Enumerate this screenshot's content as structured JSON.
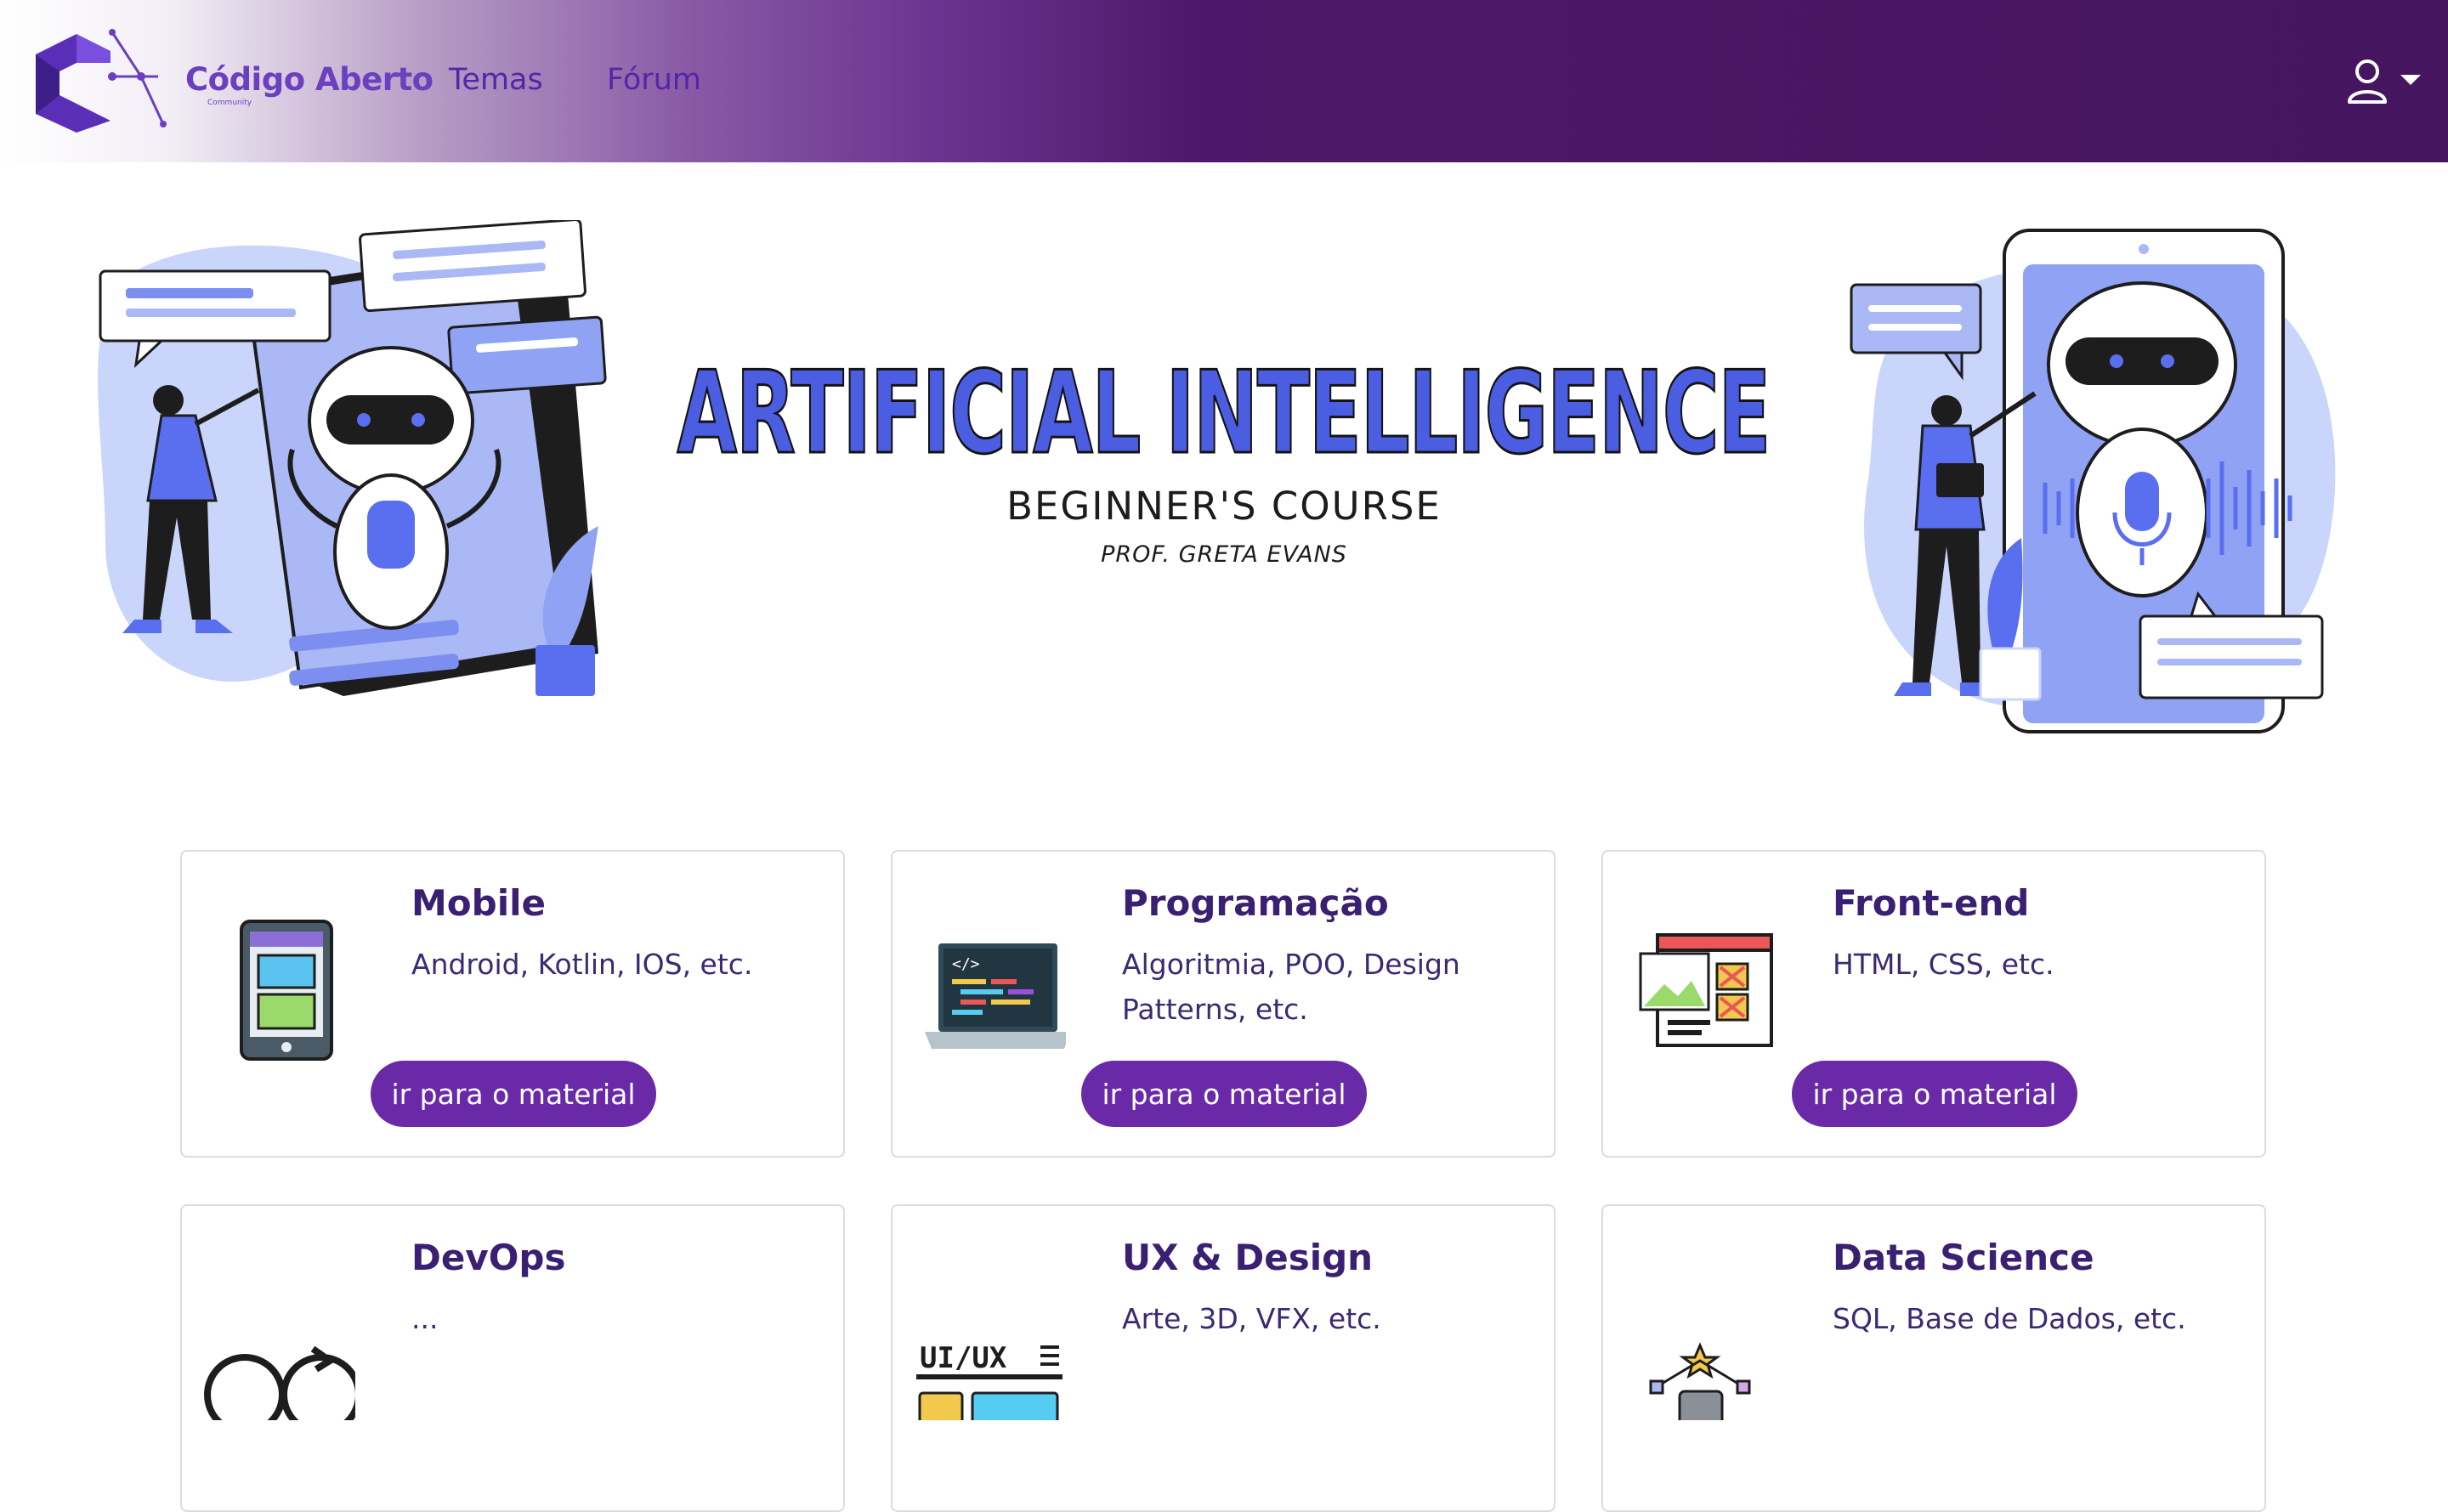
{
  "brand": {
    "name": "Código Aberto",
    "tagline": "Community"
  },
  "nav": {
    "temas": "Temas",
    "forum": "Fórum"
  },
  "hero": {
    "title": "ARTIFICIAL INTELLIGENCE",
    "subtitle": "BEGINNER'S COURSE",
    "author": "PROF. GRETA EVANS"
  },
  "cards": [
    {
      "title": "Mobile",
      "desc": "Android, Kotlin, IOS, etc.",
      "button": "ir para o material",
      "icon": "phone-icon"
    },
    {
      "title": "Programação",
      "desc": "Algoritmia, POO, Design Patterns, etc.",
      "button": "ir para o material",
      "icon": "laptop-code-icon"
    },
    {
      "title": "Front-end",
      "desc": "HTML, CSS, etc.",
      "button": "ir para o material",
      "icon": "web-design-icon"
    },
    {
      "title": "DevOps",
      "desc": "...",
      "icon": "devops-icon"
    },
    {
      "title": "UX & Design",
      "desc": "Arte, 3D, VFX, etc.",
      "icon": "ui-ux-icon"
    },
    {
      "title": "Data Science",
      "desc": "SQL, Base de Dados, etc.",
      "icon": "data-science-icon"
    }
  ],
  "colors": {
    "brand": "#6a3fc0",
    "button": "#6a2aa8",
    "nav_dark": "#451560",
    "accent_blue": "#4b5de0"
  }
}
